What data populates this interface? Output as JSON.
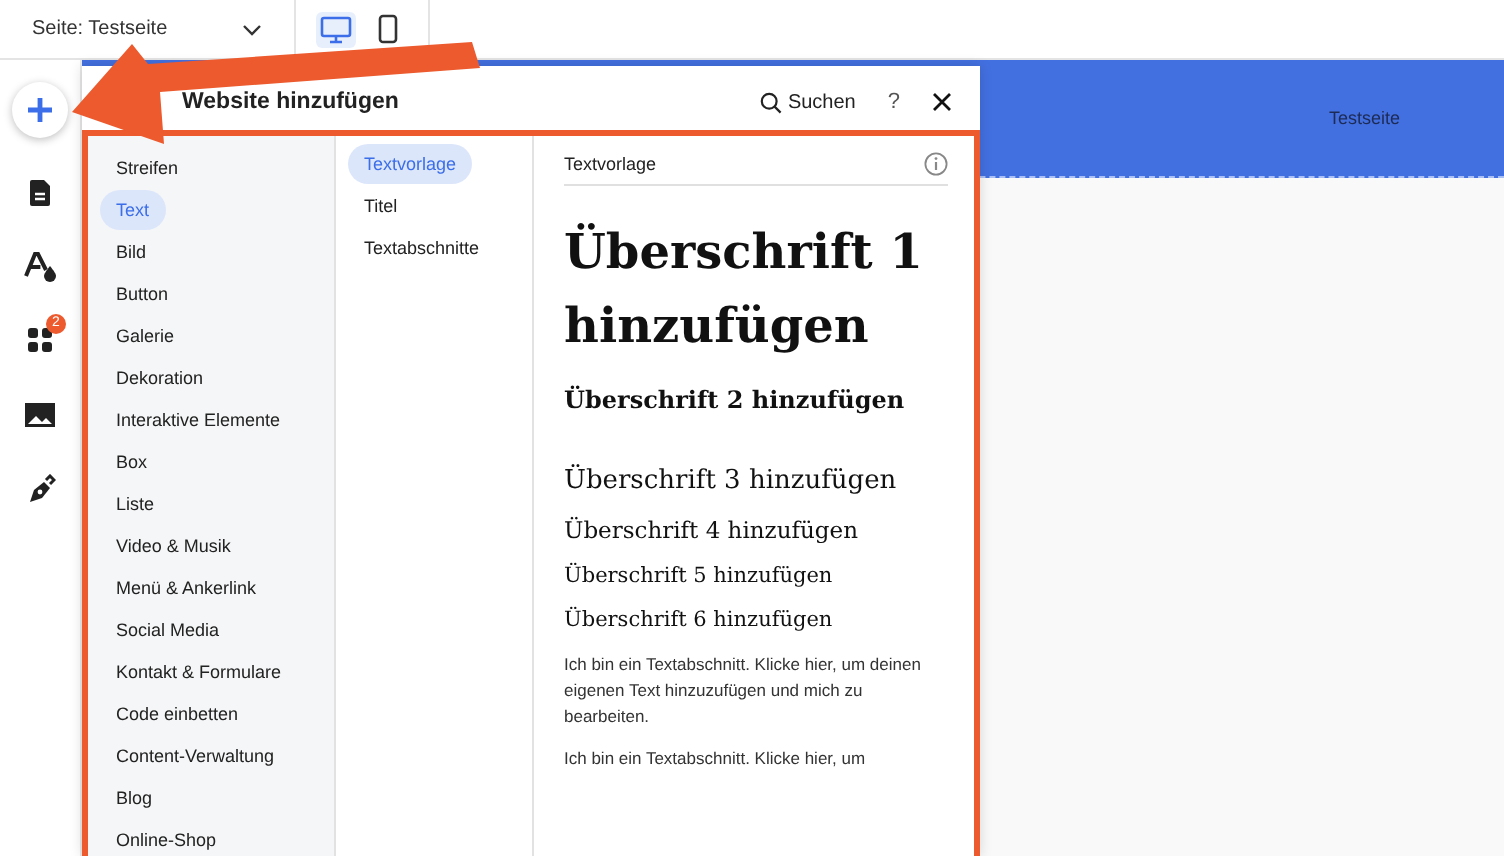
{
  "top_bar": {
    "page_selector": {
      "label": "Seite: Testseite"
    },
    "views": [
      {
        "kind": "desktop",
        "selected": true
      },
      {
        "kind": "mobile",
        "selected": false
      }
    ]
  },
  "left_rail": {
    "items": [
      {
        "kind": "add"
      },
      {
        "kind": "pages"
      },
      {
        "kind": "design"
      },
      {
        "kind": "apps",
        "badge": "2"
      },
      {
        "kind": "media"
      },
      {
        "kind": "pen"
      }
    ]
  },
  "site_header": {
    "title": "Testseite"
  },
  "panel": {
    "title": "Website hinzufügen",
    "search": "Suchen",
    "help": "?",
    "categories": [
      {
        "label": "Streifen",
        "selected": false
      },
      {
        "label": "Text",
        "selected": true
      },
      {
        "label": "Bild",
        "selected": false
      },
      {
        "label": "Button",
        "selected": false
      },
      {
        "label": "Galerie",
        "selected": false
      },
      {
        "label": "Dekoration",
        "selected": false
      },
      {
        "label": "Interaktive Elemente",
        "selected": false
      },
      {
        "label": "Box",
        "selected": false
      },
      {
        "label": "Liste",
        "selected": false
      },
      {
        "label": "Video & Musik",
        "selected": false
      },
      {
        "label": "Menü & Ankerlink",
        "selected": false
      },
      {
        "label": "Social Media",
        "selected": false
      },
      {
        "label": "Kontakt & Formulare",
        "selected": false
      },
      {
        "label": "Code einbetten",
        "selected": false
      },
      {
        "label": "Content-Verwaltung",
        "selected": false
      },
      {
        "label": "Blog",
        "selected": false
      },
      {
        "label": "Online-Shop",
        "selected": false
      }
    ],
    "subcategories": [
      {
        "label": "Textvorlage",
        "selected": true
      },
      {
        "label": "Titel",
        "selected": false
      },
      {
        "label": "Textabschnitte",
        "selected": false
      }
    ],
    "section_title": "Textvorlage",
    "text_presets": [
      {
        "kind": "h1",
        "text": "Überschrift 1 hinzufügen"
      },
      {
        "kind": "h2",
        "text": "Überschrift 2 hinzufügen"
      },
      {
        "kind": "h3",
        "text": "Überschrift 3 hinzufügen"
      },
      {
        "kind": "h4",
        "text": "Überschrift 4 hinzufügen"
      },
      {
        "kind": "h5",
        "text": "Überschrift 5 hinzufügen"
      },
      {
        "kind": "h6",
        "text": "Überschrift 6 hinzufügen"
      },
      {
        "kind": "paragraph",
        "text": "Ich bin ein Textabschnitt. Klicke hier, um deinen eigenen Text hinzuzufügen und mich zu bearbeiten."
      },
      {
        "kind": "paragraph",
        "text": "Ich bin ein Textabschnitt. Klicke hier, um"
      }
    ]
  }
}
